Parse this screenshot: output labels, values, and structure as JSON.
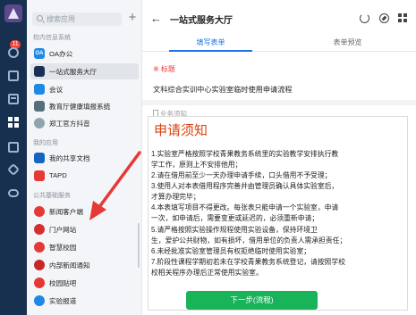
{
  "sidebar": {
    "search_placeholder": "搜索应用",
    "add_symbol": "+",
    "badge_count": "11",
    "sections": {
      "school": "校内信息系统",
      "mine": "我的应用",
      "public": "公共基础服务"
    },
    "items": [
      {
        "label": "OA办公",
        "icon": "OA",
        "color": "#1e88e5"
      },
      {
        "label": "一站式服务大厅",
        "icon": "",
        "color": "#1a2f55"
      },
      {
        "label": "会议",
        "icon": "",
        "color": "#1e88e5"
      },
      {
        "label": "教育厅健康填报系统",
        "icon": "",
        "color": "#546e7a"
      },
      {
        "label": "郑工官方抖音",
        "icon": "",
        "color": "#90a4ae"
      },
      {
        "label": "我的共享文档",
        "icon": "",
        "color": "#1565c0"
      },
      {
        "label": "TAPD",
        "icon": "",
        "color": "#e53935"
      },
      {
        "label": "新闻客户端",
        "icon": "",
        "color": "#e53935"
      },
      {
        "label": "门户网站",
        "icon": "",
        "color": "#d32f2f"
      },
      {
        "label": "智慧校园",
        "icon": "",
        "color": "#e53935"
      },
      {
        "label": "内部新闻通知",
        "icon": "",
        "color": "#c62828"
      },
      {
        "label": "校园贴吧",
        "icon": "",
        "color": "#e53935"
      },
      {
        "label": "实验报道",
        "icon": "",
        "color": "#1e88e5"
      }
    ]
  },
  "header": {
    "back": "←",
    "title": "一站式服务大厅"
  },
  "tabs": [
    {
      "label": "填写表单"
    },
    {
      "label": "表单预览"
    }
  ],
  "form": {
    "title_label": "※ 标题",
    "title_value": "文科综合实训中心实验室临时使用申请流程",
    "notice_label": "业务须知",
    "notice_heading": "申请须知",
    "rules": [
      "1.实验室严格按照学校青果教务系统里的实验教学安排执行教",
      "学工作，原则上不安排他用；",
      "2.请在借用前至少一天办理申请手续，口头借用不予受理；",
      "3.使用人对本表借用程序完善并由管理员确认具体实验室后，",
      "才算办理完毕；",
      "4.本表填写项目不得更改。每张表只能申请一个实验室，申请",
      "一次，如申请后，需要变更或延迟的，必须重新申请；",
      "5.请严格按照实验操作规程使用实验设备，保持环境卫",
      "生，爱护公共财物，如有损坏，借用单位的负责人需承担责任；",
      "6.未经批准实验室管理员有权拒绝临时使用实验室；",
      "7.阶段性课程学期初若未在学校青果教务系统登记，请按照学校",
      "校相关程序办理后正常使用实验室。"
    ],
    "next_button": "下一步(流程)"
  },
  "colors": {
    "accent": "#1a73e8",
    "required": "#e53935",
    "heading": "#d84315",
    "primary_button": "#19b35a",
    "rail": "#17304f"
  }
}
